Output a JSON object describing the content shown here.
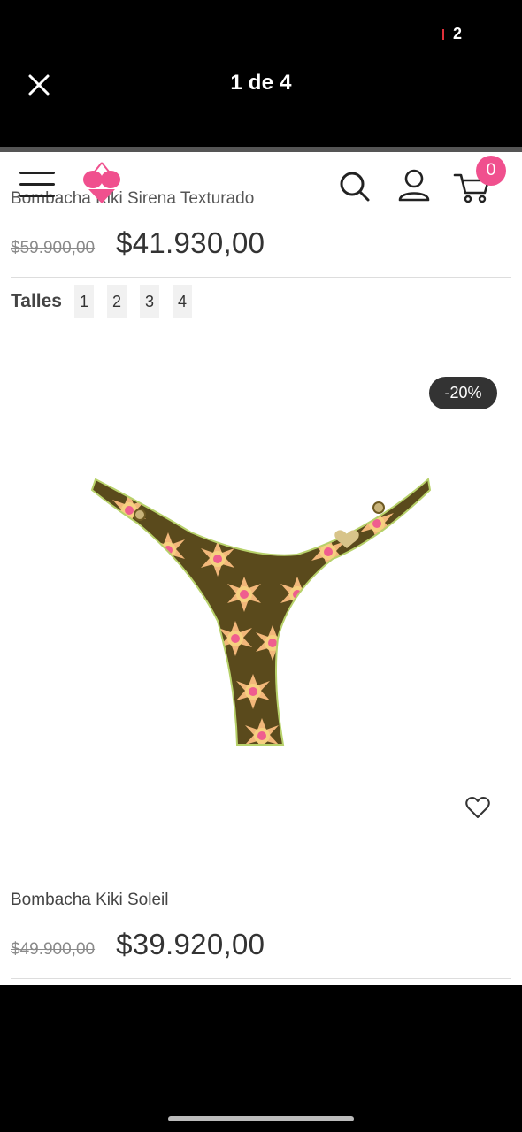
{
  "viewer": {
    "status_count": "2",
    "title": "1 de 4",
    "close_icon": "close-icon"
  },
  "header": {
    "menu_icon": "hamburger-icon",
    "logo": "bikini-heart-logo",
    "search_icon": "search-icon",
    "user_icon": "user-icon",
    "cart_icon": "cart-icon",
    "cart_count": "0",
    "brand_color": "#f0508e"
  },
  "previous_product": {
    "name": "Bombacha Kiki Sirena Texturado",
    "old_price": "$59.900,00",
    "price": "$41.930,00"
  },
  "sizes": {
    "label": "Talles",
    "options": [
      "1",
      "2",
      "3",
      "4"
    ]
  },
  "product": {
    "discount_badge": "-20%",
    "image": "floral-bikini-bottom",
    "wishlist_icon": "heart-icon",
    "name": "Bombacha Kiki Soleil",
    "old_price": "$49.900,00",
    "price": "$39.920,00"
  }
}
